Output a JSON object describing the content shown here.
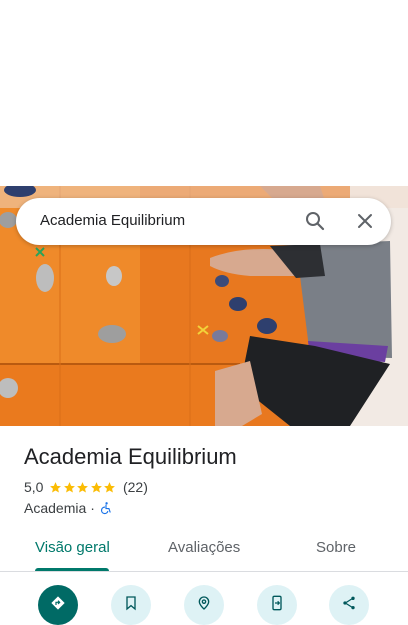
{
  "search": {
    "query": "Academia Equilibrium"
  },
  "place": {
    "name": "Academia Equilibrium",
    "rating": "5,0",
    "stars": 5,
    "review_count": "(22)",
    "category": "Academia",
    "separator": "·",
    "wheelchair_accessible": true
  },
  "tabs": [
    {
      "label": "Visão geral",
      "active": true
    },
    {
      "label": "Avaliações",
      "active": false
    },
    {
      "label": "Sobre",
      "active": false
    }
  ],
  "actions": [
    {
      "icon": "directions-icon"
    },
    {
      "icon": "bookmark-icon"
    },
    {
      "icon": "nearby-icon"
    },
    {
      "icon": "send-to-phone-icon"
    },
    {
      "icon": "share-icon"
    }
  ],
  "colors": {
    "accent": "#00796b",
    "action_bg": "#def2f5",
    "primary_action": "#006a65",
    "star": "#fbbc04"
  }
}
